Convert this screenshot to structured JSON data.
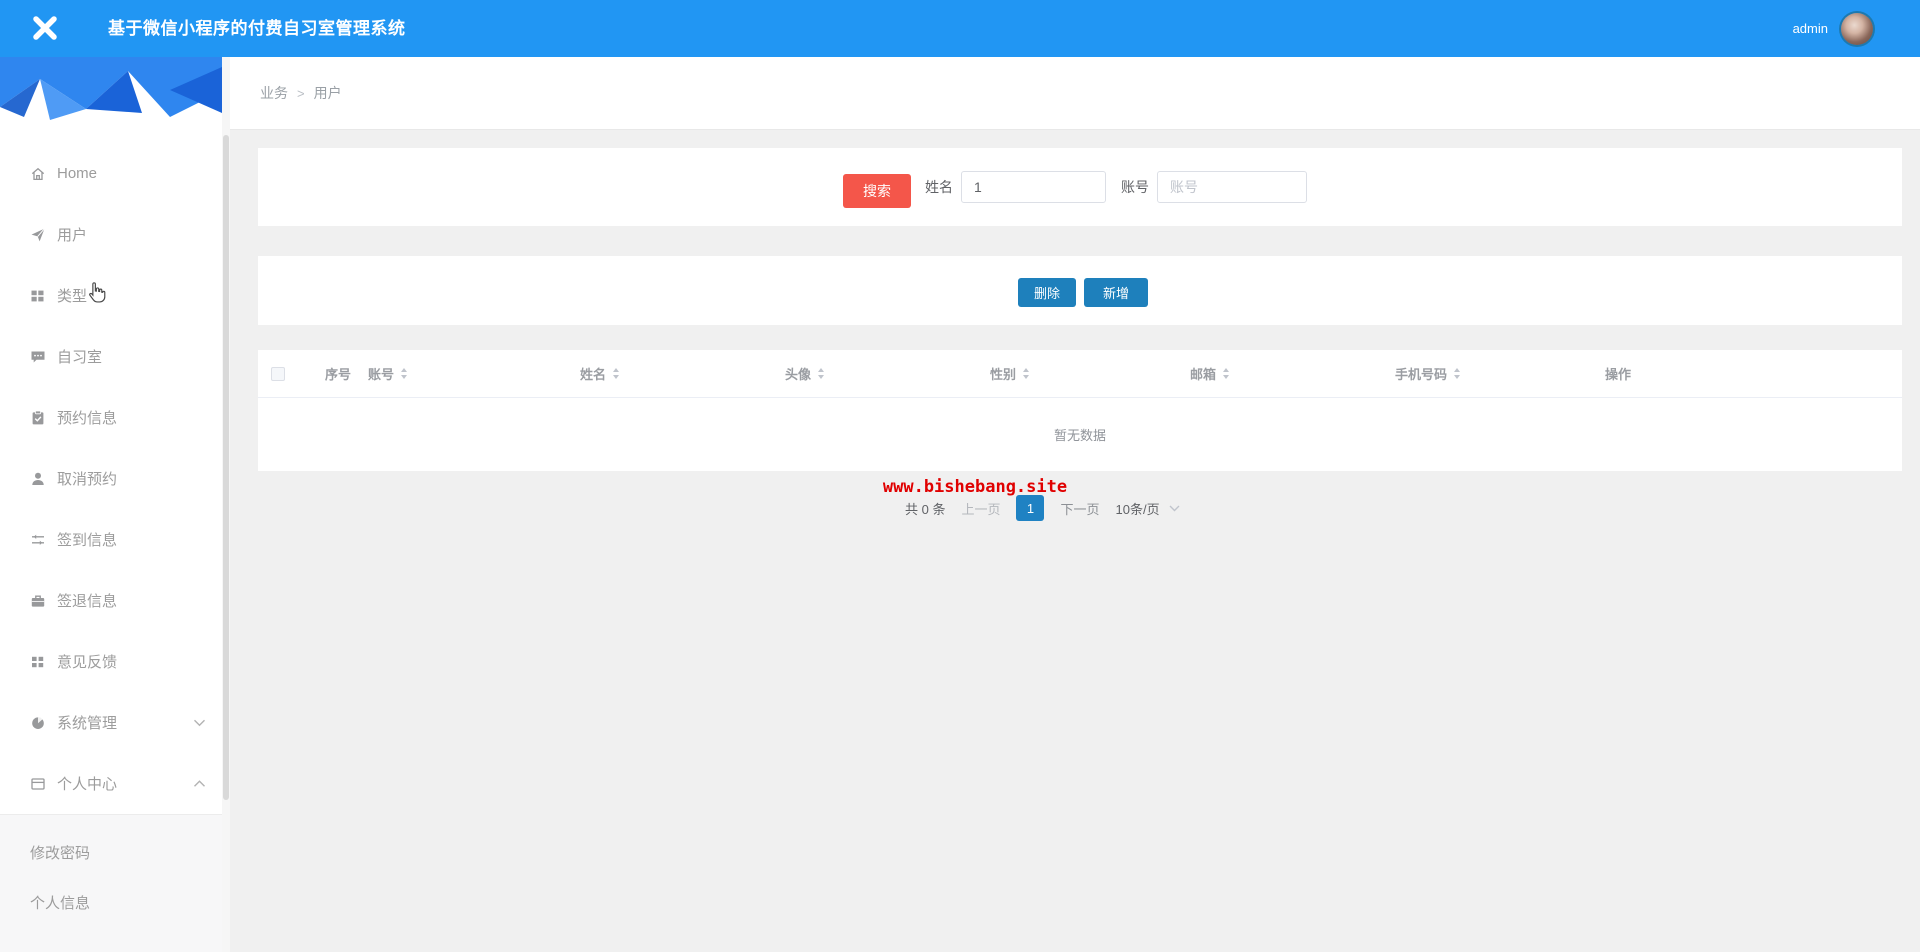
{
  "header": {
    "logo_icon": "close-icon",
    "title": "基于微信小程序的付费自习室管理系统",
    "username": "admin"
  },
  "breadcrumb": {
    "section": "业务",
    "separator": ">",
    "current": "用户"
  },
  "sidebar": {
    "items": [
      {
        "label": "Home",
        "icon": "home-icon"
      },
      {
        "label": "用户",
        "icon": "send-icon"
      },
      {
        "label": "类型",
        "icon": "grid-icon"
      },
      {
        "label": "自习室",
        "icon": "comment-icon"
      },
      {
        "label": "预约信息",
        "icon": "clipboard-check-icon"
      },
      {
        "label": "取消预约",
        "icon": "user-icon"
      },
      {
        "label": "签到信息",
        "icon": "sliders-icon"
      },
      {
        "label": "签退信息",
        "icon": "briefcase-icon"
      },
      {
        "label": "意见反馈",
        "icon": "th-grid-icon"
      },
      {
        "label": "系统管理",
        "icon": "circle-icon",
        "state": "collapsed"
      },
      {
        "label": "个人中心",
        "icon": "window-icon",
        "state": "expanded"
      }
    ],
    "submenu": [
      "修改密码",
      "个人信息"
    ]
  },
  "search": {
    "button_label": "搜索",
    "name_label": "姓名",
    "name_value": "1",
    "account_label": "账号",
    "account_placeholder": "账号"
  },
  "toolbar": {
    "delete_label": "删除",
    "add_label": "新增"
  },
  "table": {
    "columns": [
      "序号",
      "账号",
      "姓名",
      "头像",
      "性别",
      "邮箱",
      "手机号码",
      "操作"
    ],
    "sortable_columns": [
      "账号",
      "姓名",
      "头像",
      "性别",
      "邮箱",
      "手机号码"
    ],
    "empty_text": "暂无数据"
  },
  "watermark": {
    "text": "www.bishebang.site"
  },
  "pagination": {
    "total": "共 0 条",
    "prev": "上一页",
    "current": "1",
    "next": "下一页",
    "page_size": "10条/页"
  },
  "colors": {
    "header_bg": "#2196f3",
    "danger_button": "#f4564a",
    "primary_button": "#1e80bc",
    "active_page_bg": "#1f82c3",
    "watermark_red": "#e00000",
    "sidebar_text": "#9c9c9c"
  }
}
